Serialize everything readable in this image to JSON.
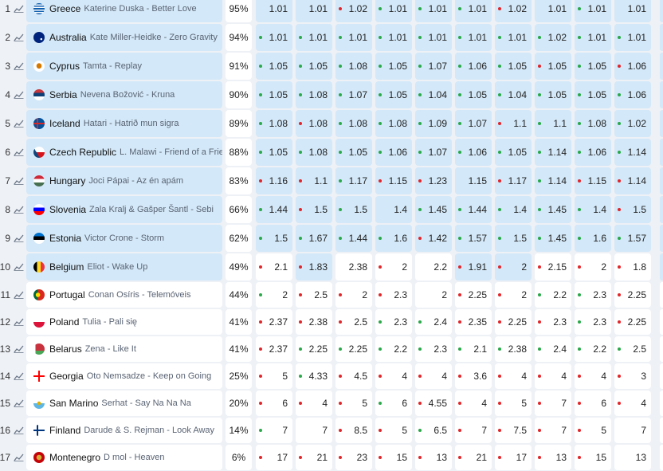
{
  "rows": [
    {
      "rank": "1",
      "country": "Greece",
      "song": "Katerine Duska - Better Love",
      "pct": "95%",
      "flag": "gr",
      "odds": [
        {
          "v": "1.01",
          "d": "n"
        },
        {
          "v": "1.01",
          "d": "n"
        },
        {
          "v": "1.02",
          "d": "r"
        },
        {
          "v": "1.01",
          "d": "g"
        },
        {
          "v": "1.01",
          "d": "g"
        },
        {
          "v": "1.01",
          "d": "g"
        },
        {
          "v": "1.02",
          "d": "r"
        },
        {
          "v": "1.01",
          "d": "n"
        },
        {
          "v": "1.01",
          "d": "g"
        },
        {
          "v": "1.01",
          "d": "n"
        }
      ]
    },
    {
      "rank": "2",
      "country": "Australia",
      "song": "Kate Miller-Heidke - Zero Gravity",
      "pct": "94%",
      "flag": "au",
      "odds": [
        {
          "v": "1.01",
          "d": "g"
        },
        {
          "v": "1.01",
          "d": "g"
        },
        {
          "v": "1.01",
          "d": "g"
        },
        {
          "v": "1.01",
          "d": "g"
        },
        {
          "v": "1.01",
          "d": "g"
        },
        {
          "v": "1.01",
          "d": "g"
        },
        {
          "v": "1.01",
          "d": "g"
        },
        {
          "v": "1.02",
          "d": "g"
        },
        {
          "v": "1.01",
          "d": "g"
        },
        {
          "v": "1.01",
          "d": "g"
        }
      ]
    },
    {
      "rank": "3",
      "country": "Cyprus",
      "song": "Tamta - Replay",
      "pct": "91%",
      "flag": "cy",
      "odds": [
        {
          "v": "1.05",
          "d": "g"
        },
        {
          "v": "1.05",
          "d": "g"
        },
        {
          "v": "1.08",
          "d": "g"
        },
        {
          "v": "1.05",
          "d": "g"
        },
        {
          "v": "1.07",
          "d": "g"
        },
        {
          "v": "1.06",
          "d": "g"
        },
        {
          "v": "1.05",
          "d": "g"
        },
        {
          "v": "1.05",
          "d": "r"
        },
        {
          "v": "1.05",
          "d": "g"
        },
        {
          "v": "1.06",
          "d": "r"
        }
      ]
    },
    {
      "rank": "4",
      "country": "Serbia",
      "song": "Nevena Božović - Kruna",
      "pct": "90%",
      "flag": "rs",
      "odds": [
        {
          "v": "1.05",
          "d": "g"
        },
        {
          "v": "1.08",
          "d": "g"
        },
        {
          "v": "1.07",
          "d": "g"
        },
        {
          "v": "1.05",
          "d": "g"
        },
        {
          "v": "1.04",
          "d": "g"
        },
        {
          "v": "1.05",
          "d": "g"
        },
        {
          "v": "1.04",
          "d": "g"
        },
        {
          "v": "1.05",
          "d": "g"
        },
        {
          "v": "1.05",
          "d": "g"
        },
        {
          "v": "1.06",
          "d": "g"
        }
      ]
    },
    {
      "rank": "5",
      "country": "Iceland",
      "song": "Hatari - Hatrið mun sigra",
      "pct": "89%",
      "flag": "is",
      "odds": [
        {
          "v": "1.08",
          "d": "g"
        },
        {
          "v": "1.08",
          "d": "r"
        },
        {
          "v": "1.08",
          "d": "g"
        },
        {
          "v": "1.08",
          "d": "g"
        },
        {
          "v": "1.09",
          "d": "g"
        },
        {
          "v": "1.07",
          "d": "g"
        },
        {
          "v": "1.1",
          "d": "r"
        },
        {
          "v": "1.1",
          "d": "g"
        },
        {
          "v": "1.08",
          "d": "g"
        },
        {
          "v": "1.02",
          "d": "g"
        }
      ]
    },
    {
      "rank": "6",
      "country": "Czech Republic",
      "song": "L. Malawi - Friend of a Friend",
      "pct": "88%",
      "flag": "cz",
      "odds": [
        {
          "v": "1.05",
          "d": "g"
        },
        {
          "v": "1.08",
          "d": "g"
        },
        {
          "v": "1.05",
          "d": "g"
        },
        {
          "v": "1.06",
          "d": "g"
        },
        {
          "v": "1.07",
          "d": "g"
        },
        {
          "v": "1.06",
          "d": "g"
        },
        {
          "v": "1.05",
          "d": "g"
        },
        {
          "v": "1.14",
          "d": "g"
        },
        {
          "v": "1.06",
          "d": "g"
        },
        {
          "v": "1.14",
          "d": "g"
        }
      ]
    },
    {
      "rank": "7",
      "country": "Hungary",
      "song": "Joci Pápai - Az én apám",
      "pct": "83%",
      "flag": "hu",
      "odds": [
        {
          "v": "1.16",
          "d": "r"
        },
        {
          "v": "1.1",
          "d": "r"
        },
        {
          "v": "1.17",
          "d": "g"
        },
        {
          "v": "1.15",
          "d": "r"
        },
        {
          "v": "1.23",
          "d": "r"
        },
        {
          "v": "1.15",
          "d": "n"
        },
        {
          "v": "1.17",
          "d": "r"
        },
        {
          "v": "1.14",
          "d": "g"
        },
        {
          "v": "1.15",
          "d": "r"
        },
        {
          "v": "1.14",
          "d": "r"
        }
      ]
    },
    {
      "rank": "8",
      "country": "Slovenia",
      "song": "Zala Kralj & Gašper Šantl - Sebi",
      "pct": "66%",
      "flag": "si",
      "odds": [
        {
          "v": "1.44",
          "d": "g"
        },
        {
          "v": "1.5",
          "d": "r"
        },
        {
          "v": "1.5",
          "d": "g"
        },
        {
          "v": "1.4",
          "d": "n"
        },
        {
          "v": "1.45",
          "d": "g"
        },
        {
          "v": "1.44",
          "d": "g"
        },
        {
          "v": "1.4",
          "d": "g"
        },
        {
          "v": "1.45",
          "d": "g"
        },
        {
          "v": "1.4",
          "d": "g"
        },
        {
          "v": "1.5",
          "d": "r"
        }
      ]
    },
    {
      "rank": "9",
      "country": "Estonia",
      "song": "Victor Crone - Storm",
      "pct": "62%",
      "flag": "ee",
      "odds": [
        {
          "v": "1.5",
          "d": "g"
        },
        {
          "v": "1.67",
          "d": "g"
        },
        {
          "v": "1.44",
          "d": "g"
        },
        {
          "v": "1.6",
          "d": "g"
        },
        {
          "v": "1.42",
          "d": "r"
        },
        {
          "v": "1.57",
          "d": "g"
        },
        {
          "v": "1.5",
          "d": "g"
        },
        {
          "v": "1.45",
          "d": "g"
        },
        {
          "v": "1.6",
          "d": "g"
        },
        {
          "v": "1.57",
          "d": "g"
        }
      ]
    },
    {
      "rank": "10",
      "country": "Belgium",
      "song": "Eliot - Wake Up",
      "pct": "49%",
      "flag": "be",
      "odds": [
        {
          "v": "2.1",
          "d": "r"
        },
        {
          "v": "1.83",
          "d": "r"
        },
        {
          "v": "2.38",
          "d": "n"
        },
        {
          "v": "2",
          "d": "r"
        },
        {
          "v": "2.2",
          "d": "n"
        },
        {
          "v": "1.91",
          "d": "r"
        },
        {
          "v": "2",
          "d": "r"
        },
        {
          "v": "2.15",
          "d": "r"
        },
        {
          "v": "2",
          "d": "r"
        },
        {
          "v": "1.8",
          "d": "r"
        }
      ]
    },
    {
      "rank": "11",
      "country": "Portugal",
      "song": "Conan Osíris - Telemóveis",
      "pct": "44%",
      "flag": "pt",
      "odds": [
        {
          "v": "2",
          "d": "g"
        },
        {
          "v": "2.5",
          "d": "r"
        },
        {
          "v": "2",
          "d": "r"
        },
        {
          "v": "2.3",
          "d": "r"
        },
        {
          "v": "2",
          "d": "n"
        },
        {
          "v": "2.25",
          "d": "r"
        },
        {
          "v": "2",
          "d": "r"
        },
        {
          "v": "2.2",
          "d": "g"
        },
        {
          "v": "2.3",
          "d": "g"
        },
        {
          "v": "2.25",
          "d": "r"
        }
      ]
    },
    {
      "rank": "12",
      "country": "Poland",
      "song": "Tulia - Pali się",
      "pct": "41%",
      "flag": "pl",
      "odds": [
        {
          "v": "2.37",
          "d": "r"
        },
        {
          "v": "2.38",
          "d": "r"
        },
        {
          "v": "2.5",
          "d": "r"
        },
        {
          "v": "2.3",
          "d": "g"
        },
        {
          "v": "2.4",
          "d": "g"
        },
        {
          "v": "2.35",
          "d": "r"
        },
        {
          "v": "2.25",
          "d": "r"
        },
        {
          "v": "2.3",
          "d": "r"
        },
        {
          "v": "2.3",
          "d": "g"
        },
        {
          "v": "2.25",
          "d": "r"
        }
      ]
    },
    {
      "rank": "13",
      "country": "Belarus",
      "song": "Zena - Like It",
      "pct": "41%",
      "flag": "by",
      "odds": [
        {
          "v": "2.37",
          "d": "r"
        },
        {
          "v": "2.25",
          "d": "g"
        },
        {
          "v": "2.25",
          "d": "g"
        },
        {
          "v": "2.2",
          "d": "g"
        },
        {
          "v": "2.3",
          "d": "g"
        },
        {
          "v": "2.1",
          "d": "g"
        },
        {
          "v": "2.38",
          "d": "g"
        },
        {
          "v": "2.4",
          "d": "g"
        },
        {
          "v": "2.2",
          "d": "g"
        },
        {
          "v": "2.5",
          "d": "g"
        }
      ]
    },
    {
      "rank": "14",
      "country": "Georgia",
      "song": "Oto Nemsadze - Keep on Going",
      "pct": "25%",
      "flag": "ge",
      "odds": [
        {
          "v": "5",
          "d": "r"
        },
        {
          "v": "4.33",
          "d": "g"
        },
        {
          "v": "4.5",
          "d": "r"
        },
        {
          "v": "4",
          "d": "r"
        },
        {
          "v": "4",
          "d": "r"
        },
        {
          "v": "3.6",
          "d": "r"
        },
        {
          "v": "4",
          "d": "r"
        },
        {
          "v": "4",
          "d": "r"
        },
        {
          "v": "4",
          "d": "r"
        },
        {
          "v": "3",
          "d": "r"
        }
      ]
    },
    {
      "rank": "15",
      "country": "San Marino",
      "song": "Serhat - Say Na Na Na",
      "pct": "20%",
      "flag": "sm",
      "odds": [
        {
          "v": "6",
          "d": "r"
        },
        {
          "v": "4",
          "d": "r"
        },
        {
          "v": "5",
          "d": "r"
        },
        {
          "v": "6",
          "d": "g"
        },
        {
          "v": "4.55",
          "d": "r"
        },
        {
          "v": "4",
          "d": "r"
        },
        {
          "v": "5",
          "d": "r"
        },
        {
          "v": "7",
          "d": "r"
        },
        {
          "v": "6",
          "d": "r"
        },
        {
          "v": "4",
          "d": "r"
        }
      ]
    },
    {
      "rank": "16",
      "country": "Finland",
      "song": "Darude & S. Rejman - Look Away",
      "pct": "14%",
      "flag": "fi",
      "odds": [
        {
          "v": "7",
          "d": "g"
        },
        {
          "v": "7",
          "d": "n"
        },
        {
          "v": "8.5",
          "d": "r"
        },
        {
          "v": "5",
          "d": "r"
        },
        {
          "v": "6.5",
          "d": "g"
        },
        {
          "v": "7",
          "d": "r"
        },
        {
          "v": "7.5",
          "d": "r"
        },
        {
          "v": "7",
          "d": "r"
        },
        {
          "v": "5",
          "d": "r"
        },
        {
          "v": "7",
          "d": "n"
        }
      ]
    },
    {
      "rank": "17",
      "country": "Montenegro",
      "song": "D mol - Heaven",
      "pct": "6%",
      "flag": "me",
      "odds": [
        {
          "v": "17",
          "d": "r"
        },
        {
          "v": "21",
          "d": "r"
        },
        {
          "v": "23",
          "d": "r"
        },
        {
          "v": "15",
          "d": "r"
        },
        {
          "v": "13",
          "d": "r"
        },
        {
          "v": "21",
          "d": "r"
        },
        {
          "v": "17",
          "d": "r"
        },
        {
          "v": "13",
          "d": "r"
        },
        {
          "v": "15",
          "d": "r"
        },
        {
          "v": "13",
          "d": "n"
        }
      ]
    }
  ],
  "icons": {
    "trend": "line-chart-icon"
  },
  "colors": {
    "qualified_bg": "#d3e8f8",
    "row_bg": "#ffffff",
    "up": "#2aa84a",
    "down": "#e0262b"
  }
}
